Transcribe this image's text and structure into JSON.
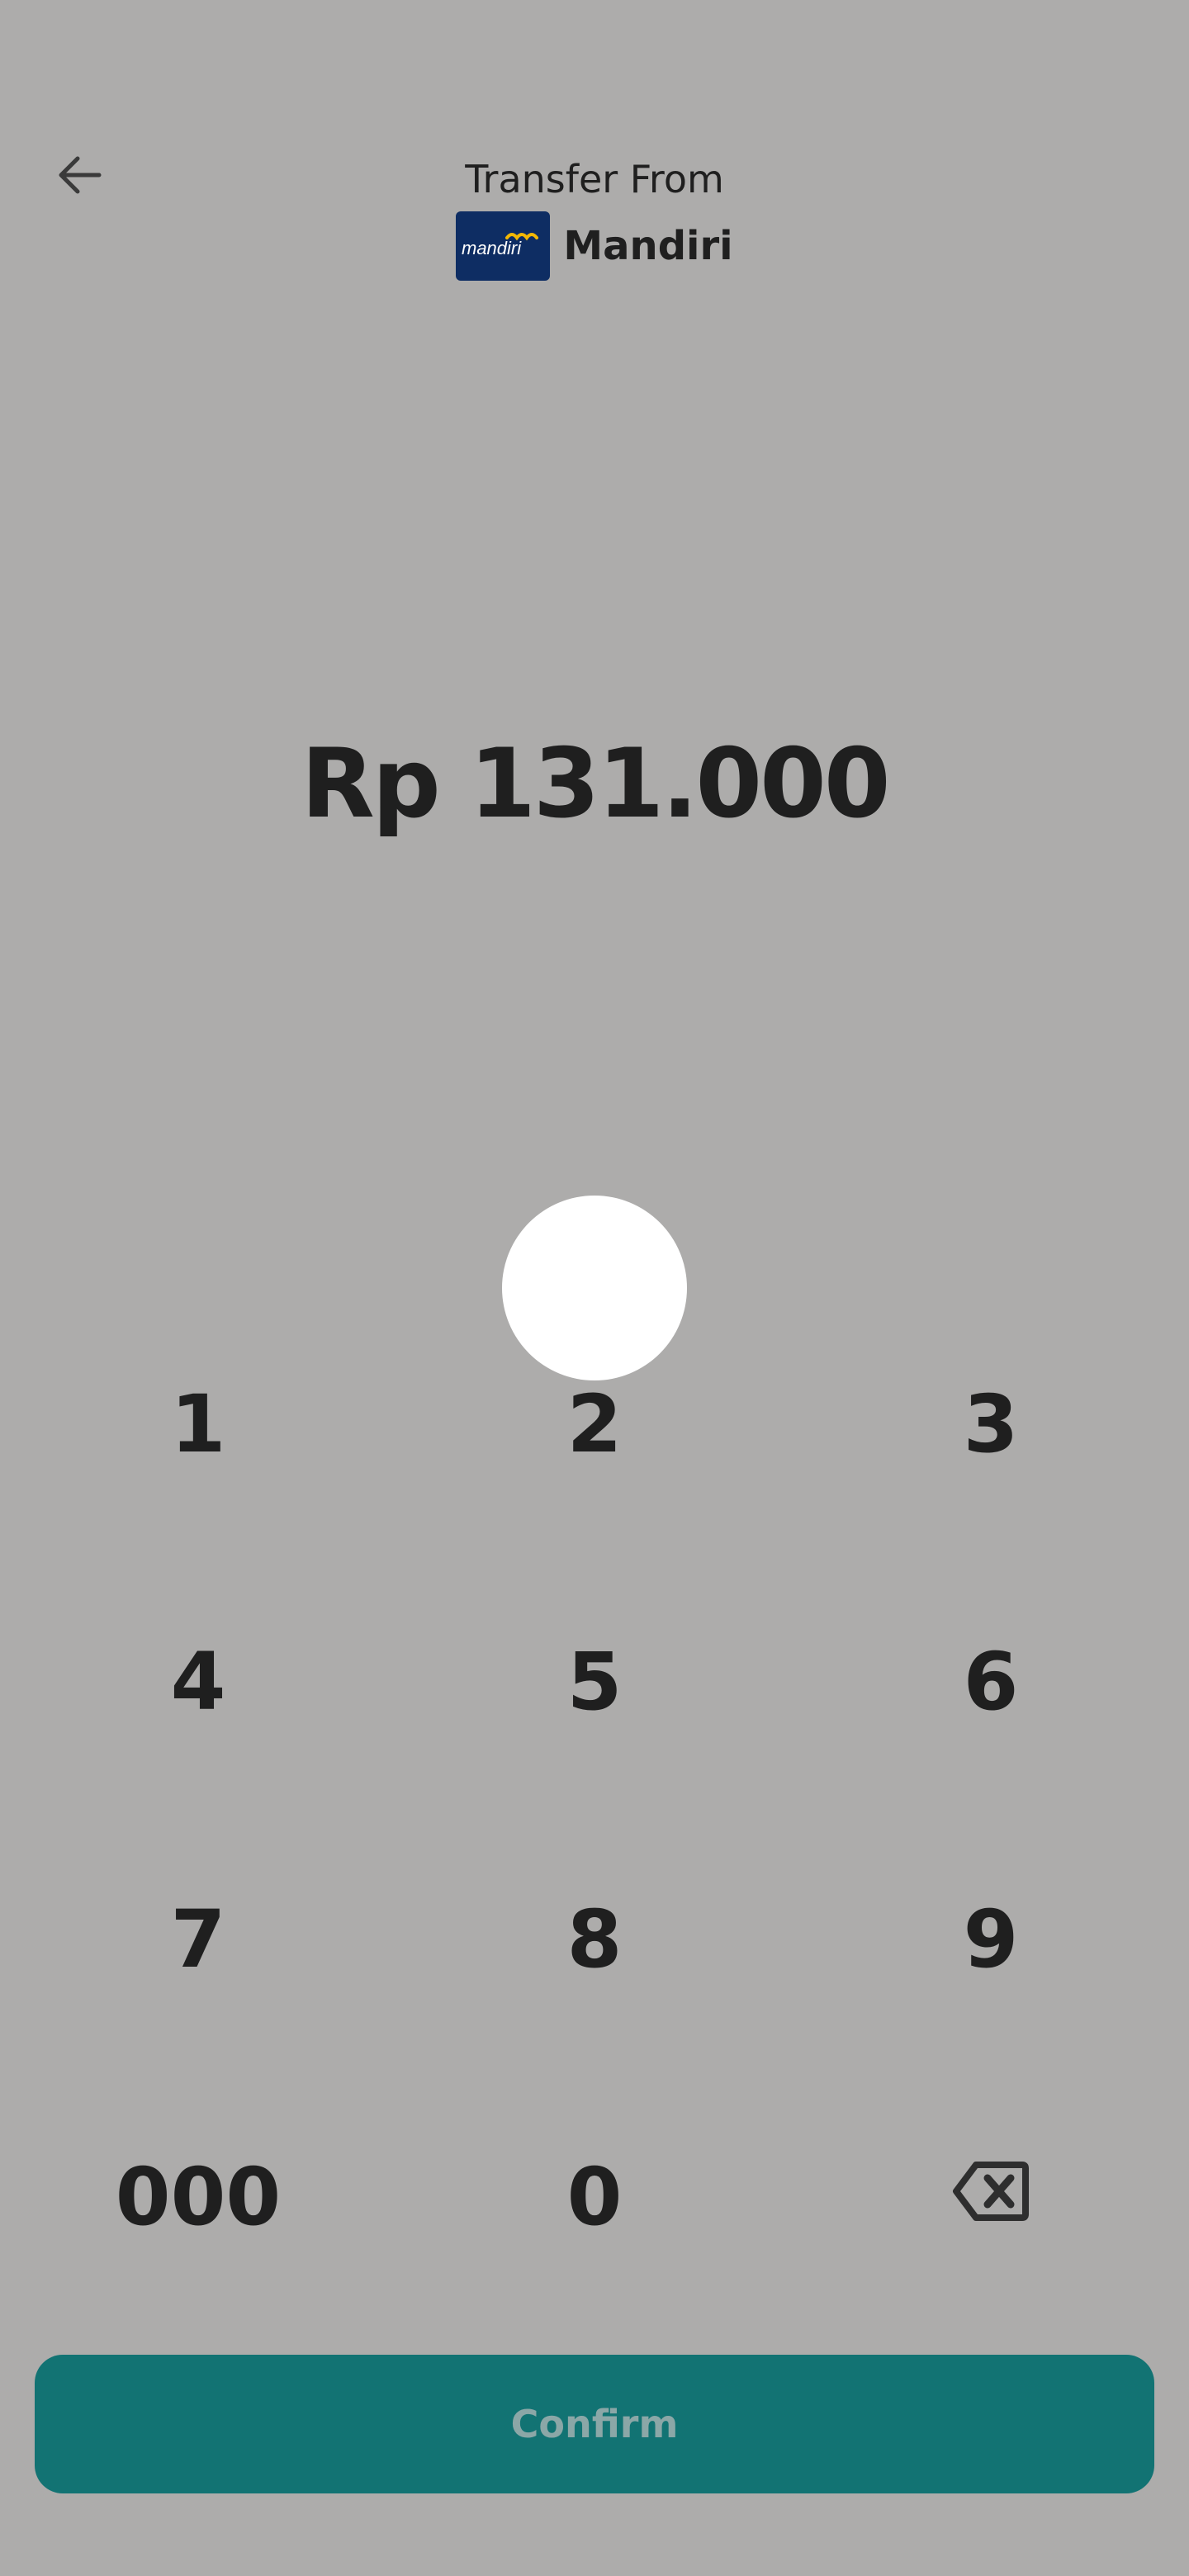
{
  "header": {
    "title": "Transfer From",
    "back_icon": "arrow-left-icon"
  },
  "bank": {
    "logo_text": "mandiri",
    "name": "Mandiri",
    "logo_bg": "#0e2d63",
    "logo_accent": "#f2b705"
  },
  "amount": {
    "display": "Rp 131.000"
  },
  "keypad": {
    "keys": [
      "1",
      "2",
      "3",
      "4",
      "5",
      "6",
      "7",
      "8",
      "9",
      "000",
      "0"
    ],
    "backspace_icon": "backspace-icon"
  },
  "confirm": {
    "label": "Confirm",
    "bg": "#127373",
    "text_color": "#8ba7a7"
  },
  "colors": {
    "background": "#adacab",
    "text": "#1f1f1f"
  }
}
